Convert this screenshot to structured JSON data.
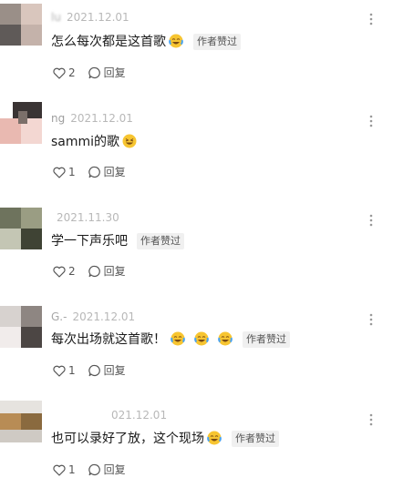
{
  "comments": [
    {
      "username": "lu",
      "date": "2021.12.01",
      "text": "怎么每次都是这首歌",
      "emojis": [
        "laugh-cry-emoji"
      ],
      "author_liked": "作者赞过",
      "likes": "2",
      "reply_label": "回复",
      "avatar_colors": [
        "#9a8f88",
        "#d9c6bd",
        "#5f5a58",
        "#c4b2aa"
      ]
    },
    {
      "username": "ng",
      "date": "2021.12.01",
      "text": "sammi的歌",
      "emojis": [
        "grin-emoji"
      ],
      "author_liked": "",
      "likes": "1",
      "reply_label": "回复",
      "avatar_colors": [
        "#3a3434",
        "#e9b9b1",
        "#f3d7d2",
        "#7b6f6a"
      ]
    },
    {
      "username": "",
      "date": "2021.11.30",
      "text": "学一下声乐吧",
      "emojis": [],
      "author_liked": "作者赞过",
      "likes": "2",
      "reply_label": "回复",
      "avatar_colors": [
        "#6e735d",
        "#9a9d83",
        "#3f4334",
        "#c4c6b4"
      ]
    },
    {
      "username": "G.-",
      "date": "2021.12.01",
      "text": "每次出场就这首歌！",
      "emojis": [
        "laugh-cry-emoji",
        "laugh-cry-emoji",
        "laugh-cry-emoji"
      ],
      "author_liked": "作者赞过",
      "likes": "1",
      "reply_label": "回复",
      "avatar_colors": [
        "#d7d2cf",
        "#8e8682",
        "#f1eceb",
        "#4c4644"
      ]
    },
    {
      "username": "",
      "date": "021.12.01",
      "text": "也可以录好了放，这个现场",
      "emojis": [
        "laugh-cry-emoji"
      ],
      "author_liked": "作者赞过",
      "likes": "1",
      "reply_label": "回复",
      "avatar_colors": [
        "#b88c55",
        "#e6e3df",
        "#8a6a3f",
        "#cfcac4"
      ]
    }
  ]
}
